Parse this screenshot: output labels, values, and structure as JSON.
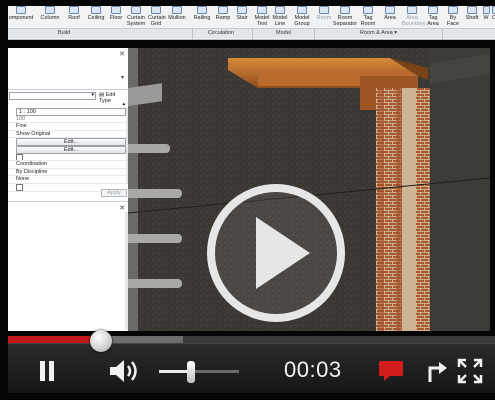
{
  "ribbon": {
    "tools": [
      {
        "label": "omponent",
        "icon": "component-icon"
      },
      {
        "label": "Column",
        "icon": "column-icon"
      },
      {
        "label": "Roof",
        "icon": "roof-icon"
      },
      {
        "label": "Ceiling",
        "icon": "ceiling-icon"
      },
      {
        "label": "Floor",
        "icon": "floor-icon"
      },
      {
        "label": "Curtain System",
        "icon": "curtain-system-icon"
      },
      {
        "label": "Curtain Grid",
        "icon": "curtain-grid-icon"
      },
      {
        "label": "Mullion",
        "icon": "mullion-icon"
      },
      {
        "label": "Railing",
        "icon": "railing-icon"
      },
      {
        "label": "Ramp",
        "icon": "ramp-icon"
      },
      {
        "label": "Stair",
        "icon": "stair-icon"
      },
      {
        "label": "Model Text",
        "icon": "model-text-icon"
      },
      {
        "label": "Model Line",
        "icon": "model-line-icon"
      },
      {
        "label": "Model Group",
        "icon": "model-group-icon"
      },
      {
        "label": "Room",
        "icon": "room-icon"
      },
      {
        "label": "Room Separator",
        "icon": "room-separator-icon"
      },
      {
        "label": "Tag Room",
        "icon": "tag-room-icon"
      },
      {
        "label": "Area",
        "icon": "area-icon"
      },
      {
        "label": "Area Boundary",
        "icon": "area-boundary-icon"
      },
      {
        "label": "Tag Area",
        "icon": "tag-area-icon"
      },
      {
        "label": "By Face",
        "icon": "by-face-icon"
      },
      {
        "label": "Shaft",
        "icon": "shaft-icon"
      },
      {
        "label": "W",
        "icon": "wall-opening-icon"
      },
      {
        "label": "O",
        "icon": "opening-icon"
      }
    ],
    "groups": {
      "build": "Build",
      "circulation": "Circulation",
      "model": "Model",
      "room_area": "Room & Area ▾"
    }
  },
  "properties": {
    "edit_type": "Edit Type",
    "rows": [
      "1 : 100",
      "100",
      "Fine",
      "Show Original",
      "Edit...",
      "Edit...",
      "",
      "Coordination",
      "By Discipline",
      "None",
      ""
    ],
    "apply": "Apply"
  },
  "player": {
    "time": "00:03",
    "progress_played": 0.19,
    "progress_buffered": 0.36,
    "volume": 0.4,
    "accent": "#c21818"
  }
}
